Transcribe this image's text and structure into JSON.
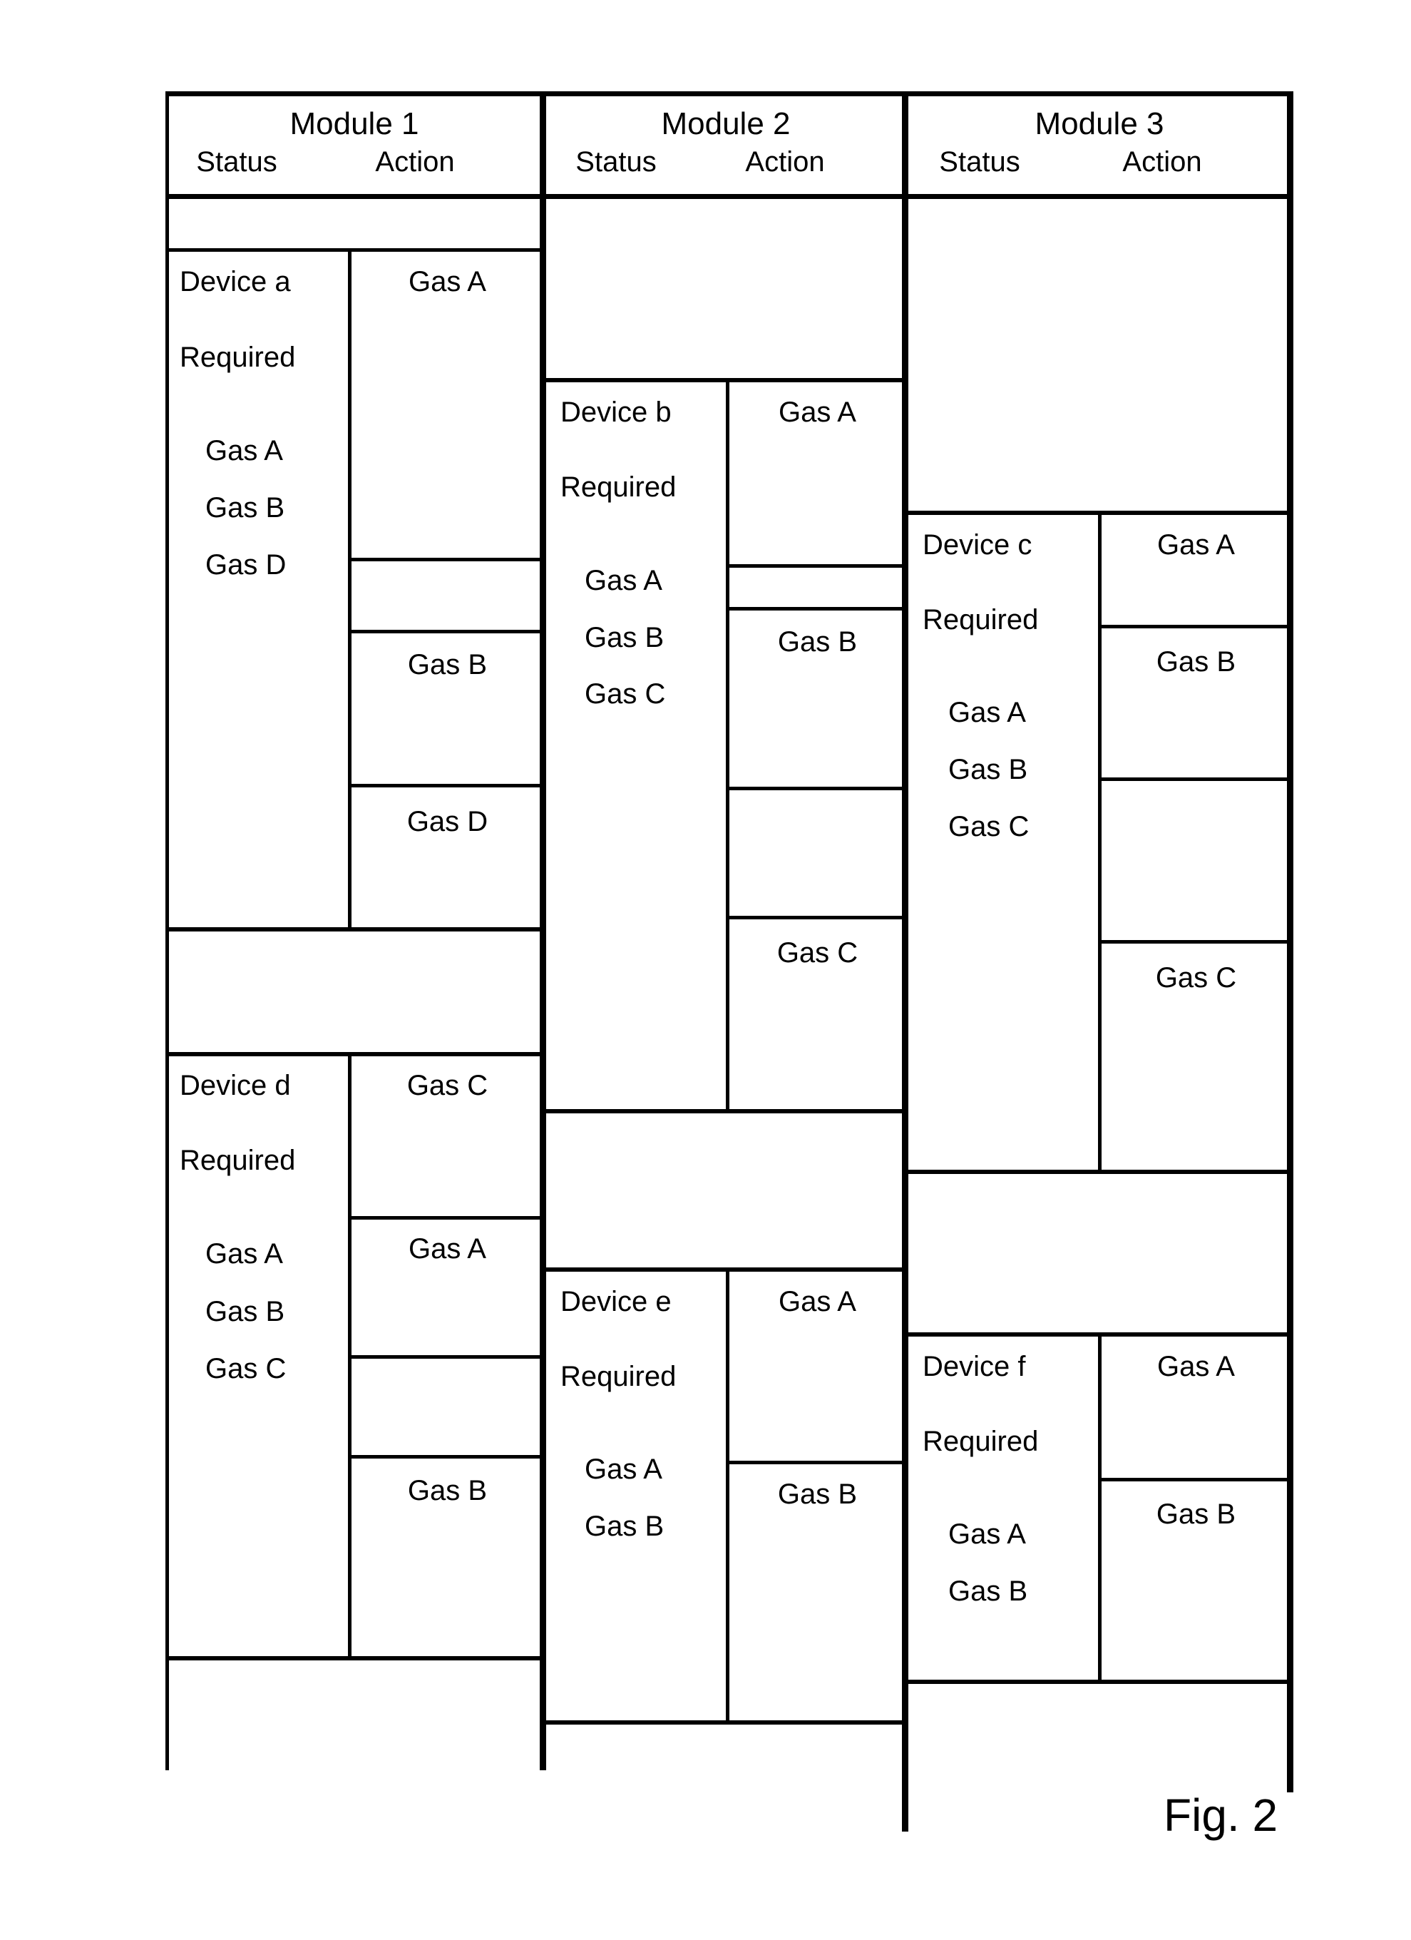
{
  "figure": {
    "caption": "Fig. 2",
    "columns": [
      "Status",
      "Action"
    ]
  },
  "modules": [
    {
      "title": "Module 1",
      "status_header": "Status",
      "action_header": "Action",
      "devices": [
        {
          "name": "Device a",
          "required_label": "Required",
          "required_gases": [
            "Gas A",
            "Gas B",
            "Gas D"
          ],
          "actions": [
            "Gas A",
            "",
            "Gas B",
            "Gas D"
          ]
        },
        {
          "name": "Device d",
          "required_label": "Required",
          "required_gases": [
            "Gas A",
            "Gas B",
            "Gas C"
          ],
          "actions": [
            "Gas C",
            "Gas A",
            "",
            "Gas B"
          ]
        }
      ]
    },
    {
      "title": "Module 2",
      "status_header": "Status",
      "action_header": "Action",
      "devices": [
        {
          "name": "Device b",
          "required_label": "Required",
          "required_gases": [
            "Gas A",
            "Gas B",
            "Gas C"
          ],
          "actions": [
            "Gas A",
            "",
            "Gas B",
            "",
            "Gas C"
          ]
        },
        {
          "name": "Device e",
          "required_label": "Required",
          "required_gases": [
            "Gas A",
            "Gas B"
          ],
          "actions": [
            "Gas A",
            "Gas B"
          ]
        }
      ]
    },
    {
      "title": "Module 3",
      "status_header": "Status",
      "action_header": "Action",
      "devices": [
        {
          "name": "Device c",
          "required_label": "Required",
          "required_gases": [
            "Gas A",
            "Gas B",
            "Gas C"
          ],
          "actions": [
            "Gas A",
            "Gas B",
            "",
            "Gas C"
          ]
        },
        {
          "name": "Device f",
          "required_label": "Required",
          "required_gases": [
            "Gas A",
            "Gas B"
          ],
          "actions": [
            "Gas A",
            "Gas B"
          ]
        }
      ]
    }
  ]
}
